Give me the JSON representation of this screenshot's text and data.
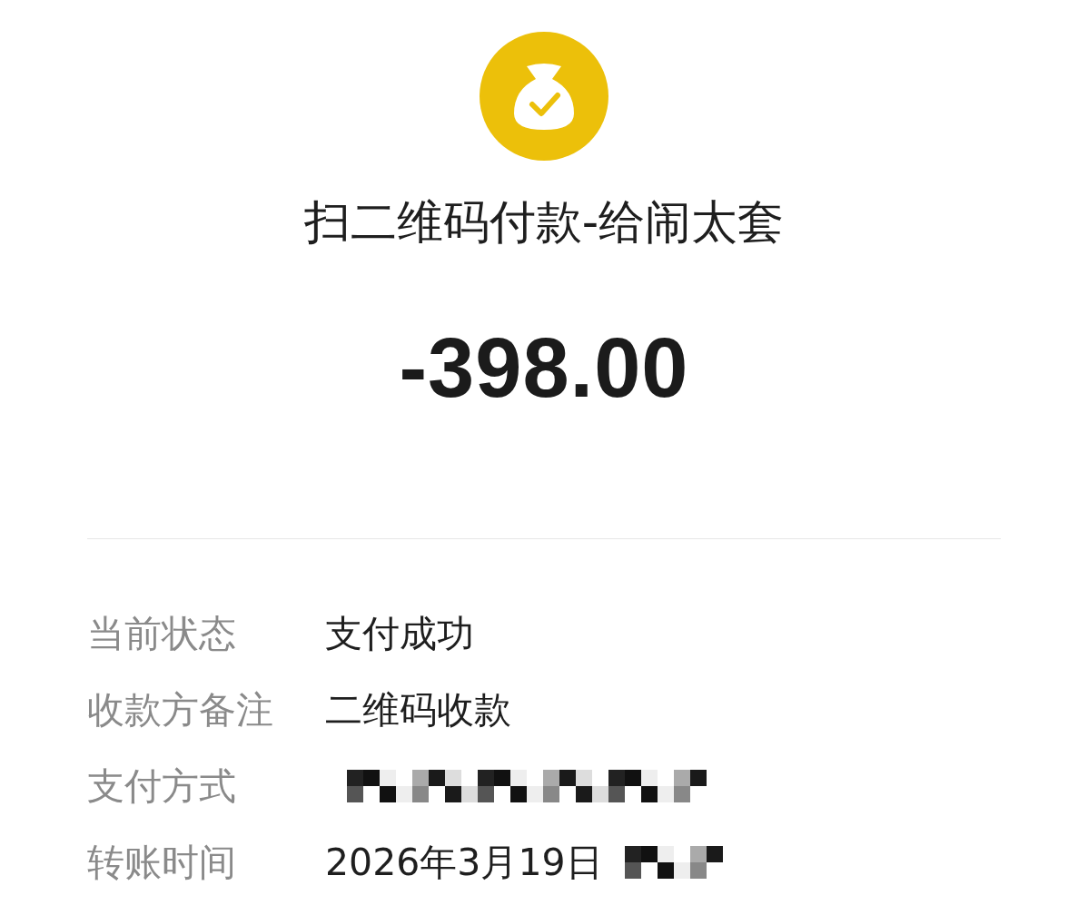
{
  "header": {
    "title": "扫二维码付款-给闹太套",
    "amount": "-398.00"
  },
  "details": [
    {
      "label": "当前状态",
      "value": "支付成功",
      "redacted": false
    },
    {
      "label": "收款方备注",
      "value": "二维码收款",
      "redacted": false
    },
    {
      "label": "支付方式",
      "redacted": true
    },
    {
      "label": "转账时间",
      "value": "2026年3月19日",
      "redacted": true
    }
  ]
}
